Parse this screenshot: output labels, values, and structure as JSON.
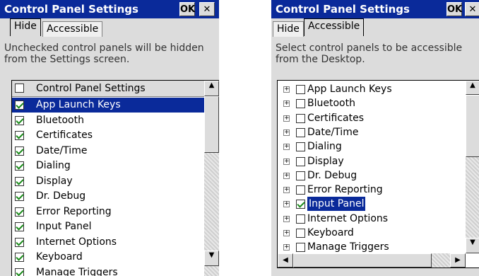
{
  "left_panel": {
    "title": "Control Panel Settings",
    "ok_label": "OK",
    "close_label": "✕",
    "tabs": [
      {
        "label": "Hide",
        "active": true
      },
      {
        "label": "Accessible",
        "active": false
      }
    ],
    "description_line1": "Unchecked control panels will be hidden",
    "description_line2": "from the Settings screen.",
    "header_label": "Control Panel Settings",
    "items": [
      {
        "label": "App Launch Keys",
        "checked": true,
        "selected": true
      },
      {
        "label": "Bluetooth",
        "checked": true
      },
      {
        "label": "Certificates",
        "checked": true
      },
      {
        "label": "Date/Time",
        "checked": true
      },
      {
        "label": "Dialing",
        "checked": true
      },
      {
        "label": "Display",
        "checked": true
      },
      {
        "label": "Dr. Debug",
        "checked": true
      },
      {
        "label": "Error Reporting",
        "checked": true
      },
      {
        "label": "Input Panel",
        "checked": true
      },
      {
        "label": "Internet Options",
        "checked": true
      },
      {
        "label": "Keyboard",
        "checked": true
      },
      {
        "label": "Manage Triggers",
        "checked": true
      }
    ]
  },
  "right_panel": {
    "title": "Control Panel Settings",
    "ok_label": "OK",
    "close_label": "✕",
    "tabs": [
      {
        "label": "Hide",
        "active": false
      },
      {
        "label": "Accessible",
        "active": true
      }
    ],
    "description_line1": "Select control panels to be accessible",
    "description_line2": "from the Desktop.",
    "items": [
      {
        "label": "App Launch Keys",
        "checked": false
      },
      {
        "label": "Bluetooth",
        "checked": false
      },
      {
        "label": "Certificates",
        "checked": false
      },
      {
        "label": "Date/Time",
        "checked": false
      },
      {
        "label": "Dialing",
        "checked": false
      },
      {
        "label": "Display",
        "checked": false
      },
      {
        "label": "Dr. Debug",
        "checked": false
      },
      {
        "label": "Error Reporting",
        "checked": false
      },
      {
        "label": "Input Panel",
        "checked": true,
        "selected": true
      },
      {
        "label": "Internet Options",
        "checked": false
      },
      {
        "label": "Keyboard",
        "checked": false
      },
      {
        "label": "Manage Triggers",
        "checked": false
      }
    ]
  },
  "colors": {
    "titlebar": "#0a2a9a",
    "selection": "#0a2a9a",
    "check": "#1a8a1a"
  }
}
